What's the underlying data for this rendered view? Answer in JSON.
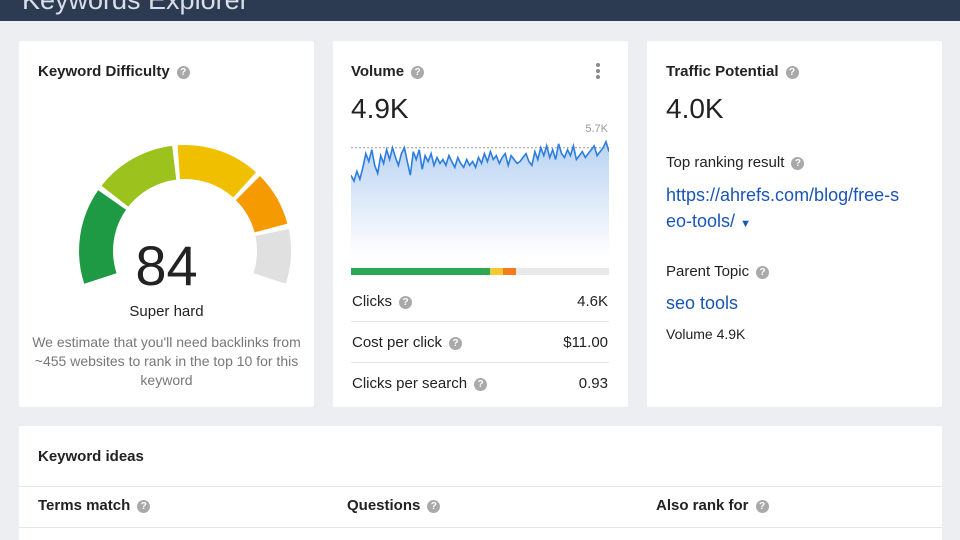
{
  "app": {
    "title": "Keywords Explorer"
  },
  "difficulty": {
    "title": "Keyword Difficulty",
    "score": "84",
    "label": "Super hard",
    "description": "We estimate that you'll need backlinks from ~455 websites to rank in the top 10 for this keyword",
    "level": 0.84,
    "colors": {
      "green": "#1f9a44",
      "yellow_green": "#9cc21e",
      "yellow": "#f0c000",
      "orange": "#f59a00",
      "gray": "#e0e0e0"
    }
  },
  "volume": {
    "title": "Volume",
    "value": "4.9K",
    "chart_max_label": "5.7K",
    "chart_data": {
      "type": "area",
      "ylim": [
        0,
        5.7
      ],
      "values": [
        3.5,
        3.2,
        3.7,
        3.3,
        3.9,
        4.6,
        4.2,
        4.8,
        4.0,
        3.6,
        4.5,
        4.1,
        4.8,
        4.3,
        4.9,
        4.4,
        4.0,
        4.6,
        4.9,
        4.2,
        3.5,
        4.7,
        4.3,
        4.8,
        3.8,
        4.5,
        4.2,
        4.6,
        4.0,
        4.4,
        4.1,
        4.3,
        4.0,
        4.5,
        4.2,
        3.9,
        4.4,
        4.1,
        3.9,
        4.3,
        4.0,
        4.2,
        3.9,
        4.4,
        4.1,
        4.6,
        4.2,
        4.7,
        4.3,
        4.5,
        4.1,
        4.4,
        4.6,
        4.0,
        4.5,
        4.3,
        4.1,
        4.2,
        4.4,
        4.6,
        4.2,
        4.0,
        4.7,
        4.3,
        4.9,
        4.5,
        5.0,
        4.4,
        4.8,
        4.3,
        5.1,
        4.6,
        4.4,
        4.8,
        4.5,
        5.0,
        4.3,
        4.5,
        4.7,
        4.4,
        4.6,
        4.8,
        5.0,
        4.5,
        4.7,
        4.9,
        5.2,
        4.7
      ],
      "reference_value": 4.9
    },
    "distribution": [
      {
        "share": 0.54,
        "color": "#2aa853"
      },
      {
        "share": 0.05,
        "color": "#f2c931"
      },
      {
        "share": 0.05,
        "color": "#f37c21"
      },
      {
        "share": 0.36,
        "color": "#e9e9e9"
      }
    ],
    "metrics": [
      {
        "label": "Clicks",
        "value": "4.6K",
        "help": true
      },
      {
        "label": "Cost per click",
        "value": "$11.00",
        "help": true
      },
      {
        "label": "Clicks per search",
        "value": "0.93",
        "help": true
      }
    ]
  },
  "traffic": {
    "title": "Traffic Potential",
    "value": "4.0K",
    "top_result_label": "Top ranking result",
    "top_result_line1": "https://ahrefs.com/blog/free-s",
    "top_result_line2": "eo-tools/",
    "parent_label": "Parent Topic",
    "parent_value": "seo tools",
    "parent_volume": "Volume 4.9K"
  },
  "ideas": {
    "title": "Keyword ideas",
    "tabs": [
      "Terms match",
      "Questions",
      "Also rank for"
    ]
  },
  "icons": {
    "help": "help-icon",
    "menu": "more-vertical-icon",
    "dropdown": "caret-down-icon"
  }
}
